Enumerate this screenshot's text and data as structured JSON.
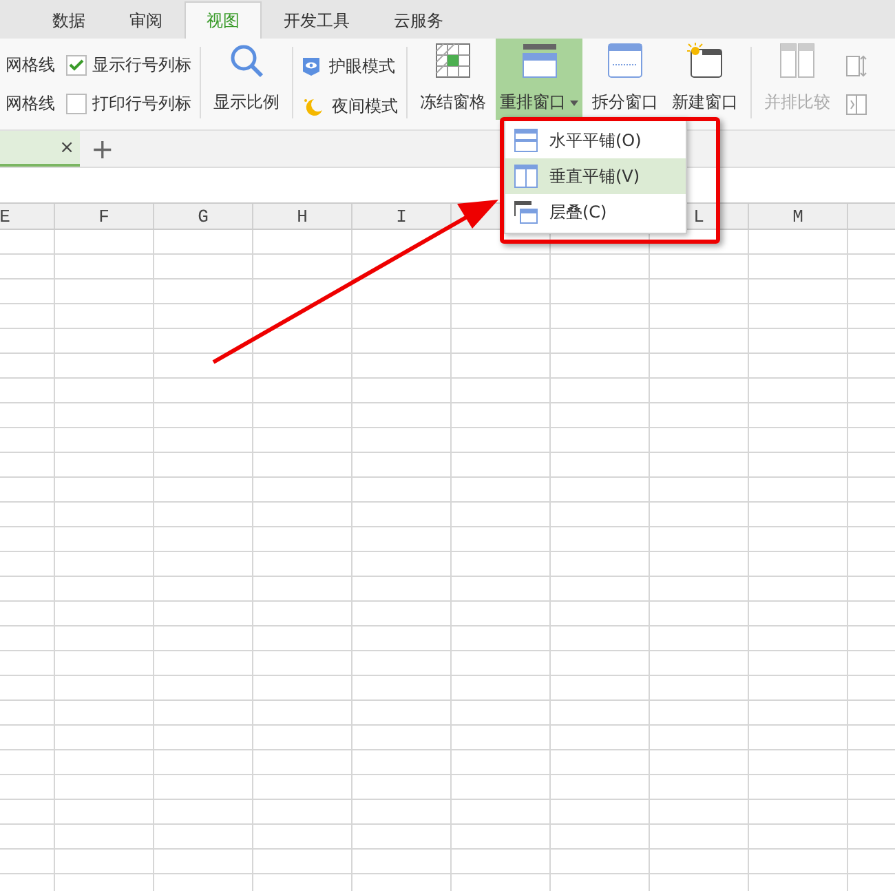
{
  "tabs": [
    {
      "label": "数据",
      "selected": false
    },
    {
      "label": "审阅",
      "selected": false
    },
    {
      "label": "视图",
      "selected": true
    },
    {
      "label": "开发工具",
      "selected": false
    },
    {
      "label": "云服务",
      "selected": false
    }
  ],
  "ribbon": {
    "cut_labels": [
      "网格线",
      "网格线"
    ],
    "checks": [
      {
        "label": "显示行号列标",
        "checked": true
      },
      {
        "label": "打印行号列标",
        "checked": false
      }
    ],
    "zoom_button": {
      "label": "显示比例"
    },
    "modes": [
      {
        "kind": "eye",
        "label": "护眼模式"
      },
      {
        "kind": "night",
        "label": "夜间模式"
      }
    ],
    "buttons": [
      {
        "kind": "freeze",
        "label": "冻结窗格",
        "active": false,
        "dropdown": false,
        "disabled": false
      },
      {
        "kind": "arrange",
        "label": "重排窗口",
        "active": true,
        "dropdown": true,
        "disabled": false
      },
      {
        "kind": "split",
        "label": "拆分窗口",
        "active": false,
        "dropdown": false,
        "disabled": false
      },
      {
        "kind": "new",
        "label": "新建窗口",
        "active": false,
        "dropdown": false,
        "disabled": false
      },
      {
        "kind": "compare",
        "label": "并排比较",
        "active": false,
        "dropdown": false,
        "disabled": true
      }
    ]
  },
  "sheet_tabs": {
    "close": "×",
    "add": "+"
  },
  "columns": [
    {
      "label": "E"
    },
    {
      "label": "F"
    },
    {
      "label": "G"
    },
    {
      "label": "H"
    },
    {
      "label": "I"
    },
    {},
    {},
    {
      "label": "L"
    },
    {
      "label": "M"
    },
    {}
  ],
  "menu": {
    "items": [
      {
        "kind": "horizontal",
        "label": "水平平铺(O)",
        "selected": false
      },
      {
        "kind": "vertical",
        "label": "垂直平铺(V)",
        "selected": true
      },
      {
        "kind": "cascade",
        "label": "层叠(C)",
        "selected": false
      }
    ]
  }
}
